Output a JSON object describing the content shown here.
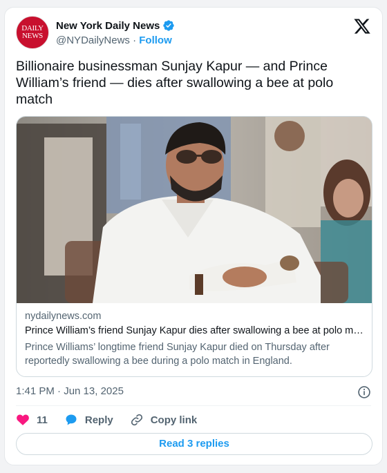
{
  "author": {
    "avatar_line1": "DAILY",
    "avatar_line2": "NEWS",
    "display_name": "New York Daily News",
    "handle": "@NYDailyNews",
    "separator": "·",
    "follow_label": "Follow"
  },
  "tweet": {
    "text": "Billionaire businessman Sunjay Kapur — and Prince William’s friend — dies after swallowing a bee at polo match"
  },
  "link_card": {
    "domain": "nydailynews.com",
    "title": "Prince William’s friend Sunjay Kapur dies after swallowing a bee at polo match",
    "description": "Prince Williams’ longtime friend Sunjay Kapur died on Thursday after reportedly swallowing a bee during a polo match in England."
  },
  "meta": {
    "timestamp": "1:41 PM · Jun 13, 2025"
  },
  "actions": {
    "like_count": "11",
    "reply_label": "Reply",
    "copy_link_label": "Copy link",
    "read_replies_label": "Read 3 replies"
  },
  "colors": {
    "accent": "#1d9bf0",
    "like": "#f91880",
    "brand_red": "#c8102e"
  },
  "icons": [
    "verified-badge-icon",
    "x-logo-icon",
    "heart-icon",
    "reply-bubble-icon",
    "link-icon",
    "info-icon"
  ]
}
